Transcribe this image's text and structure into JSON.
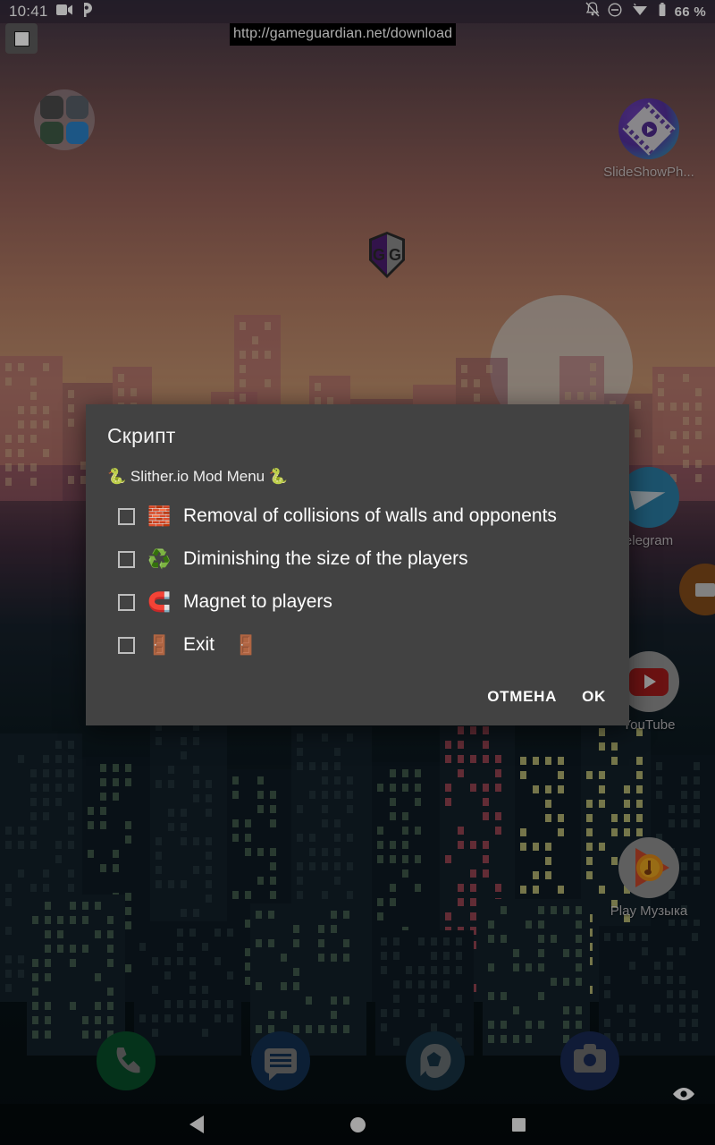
{
  "status_bar": {
    "time": "10:41",
    "battery_text": "66 %",
    "icons": [
      "screen-recorder-icon",
      "parking-p-icon",
      "notifications-muted-icon",
      "do-not-disturb-icon",
      "wifi-icon",
      "battery-icon"
    ]
  },
  "overlay": {
    "record_stop_button": "stop-recording-button",
    "url_toast": "http://gameguardian.net/download"
  },
  "desktop": {
    "icons": [
      {
        "name": "app-folder",
        "label": ""
      },
      {
        "name": "slideshow-photo",
        "label": "SlideShowPh..."
      },
      {
        "name": "telegram",
        "label": "elegram"
      },
      {
        "name": "youtube",
        "label": "YouTube"
      },
      {
        "name": "play-music",
        "label": "Play Музыка"
      }
    ],
    "floating_icon": "gameguardian-gg-icon"
  },
  "dock": {
    "items": [
      {
        "name": "phone",
        "icon": "phone-icon"
      },
      {
        "name": "messages",
        "icon": "message-icon"
      },
      {
        "name": "gallery",
        "icon": "gallery-icon"
      },
      {
        "name": "camera",
        "icon": "camera-icon"
      }
    ]
  },
  "nav_bar": {
    "back": "back-icon",
    "home": "home-icon",
    "recents": "recents-icon"
  },
  "dialog": {
    "title": "Скрипт",
    "subtitle": "🐍 Slither.io Mod Menu 🐍",
    "items": [
      {
        "checked": false,
        "emoji": "🧱",
        "label": "Removal of collisions of walls and opponents",
        "trailing": ""
      },
      {
        "checked": false,
        "emoji": "♻️",
        "label": "Diminishing the size of the players",
        "trailing": ""
      },
      {
        "checked": false,
        "emoji": "🧲",
        "label": "Magnet to players",
        "trailing": ""
      },
      {
        "checked": false,
        "emoji": "🚪",
        "label": "Exit",
        "trailing": "🚪"
      }
    ],
    "cancel_label": "ОТМЕНА",
    "ok_label": "OK"
  },
  "colors": {
    "dialog_bg": "#424242",
    "accent_text": "#ffffff",
    "status_bar_text": "#ffffff"
  }
}
